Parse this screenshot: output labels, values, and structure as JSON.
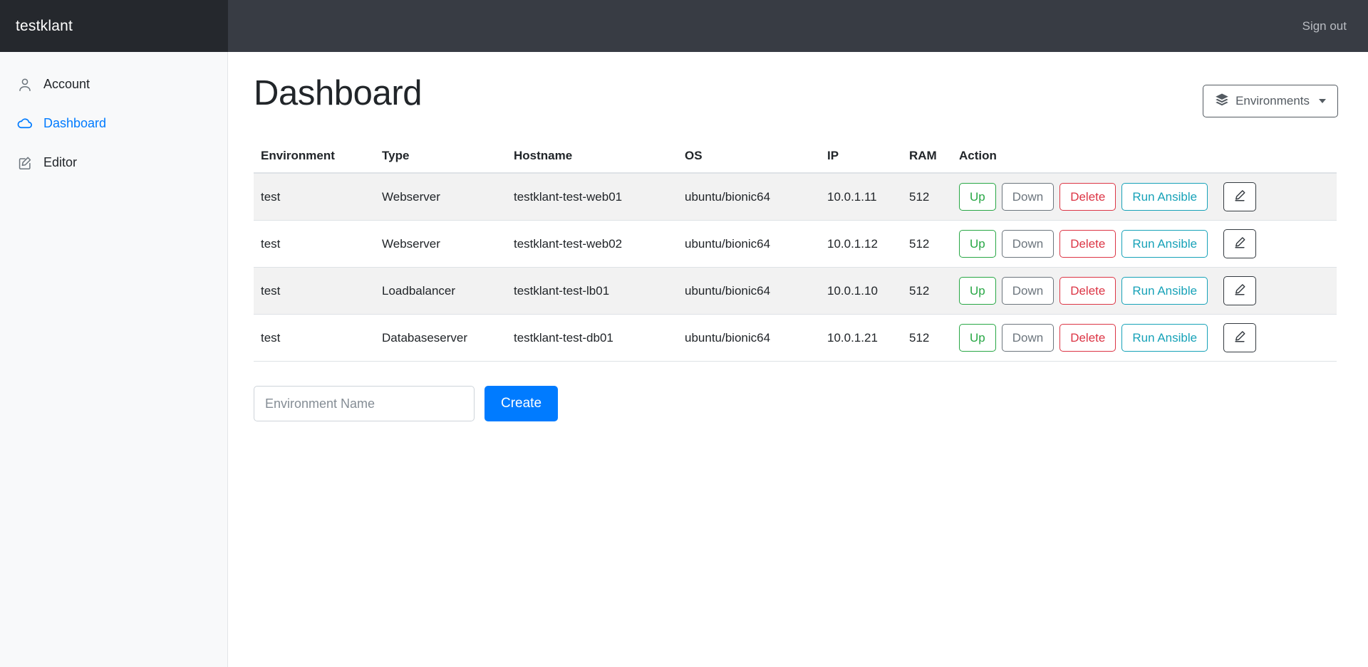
{
  "navbar": {
    "brand": "testklant",
    "signout_label": "Sign out"
  },
  "sidebar": {
    "items": [
      {
        "label": "Account",
        "icon": "person-icon",
        "active": false
      },
      {
        "label": "Dashboard",
        "icon": "cloud-icon",
        "active": true
      },
      {
        "label": "Editor",
        "icon": "pencil-square-icon",
        "active": false
      }
    ]
  },
  "main": {
    "title": "Dashboard",
    "environments_button": {
      "label": "Environments",
      "icon": "layers-icon",
      "caret": "chevron-down-icon"
    },
    "table": {
      "columns": [
        "Environment",
        "Type",
        "Hostname",
        "OS",
        "IP",
        "RAM",
        "Action"
      ],
      "rows": [
        {
          "environment": "test",
          "type": "Webserver",
          "hostname": "testklant-test-web01",
          "os": "ubuntu/bionic64",
          "ip": "10.0.1.11",
          "ram": "512"
        },
        {
          "environment": "test",
          "type": "Webserver",
          "hostname": "testklant-test-web02",
          "os": "ubuntu/bionic64",
          "ip": "10.0.1.12",
          "ram": "512"
        },
        {
          "environment": "test",
          "type": "Loadbalancer",
          "hostname": "testklant-test-lb01",
          "os": "ubuntu/bionic64",
          "ip": "10.0.1.10",
          "ram": "512"
        },
        {
          "environment": "test",
          "type": "Databaseserver",
          "hostname": "testklant-test-db01",
          "os": "ubuntu/bionic64",
          "ip": "10.0.1.21",
          "ram": "512"
        }
      ],
      "action_labels": {
        "up": "Up",
        "down": "Down",
        "delete": "Delete",
        "ansible": "Run Ansible",
        "edit_icon": "pencil-icon"
      }
    },
    "create_form": {
      "input_value": "",
      "input_placeholder": "Environment Name",
      "button_label": "Create"
    }
  },
  "colors": {
    "navbar_bg": "#383c44",
    "brand_bg": "#25282d",
    "sidebar_bg": "#f8f9fa",
    "accent_blue": "#007bff",
    "success_green": "#28a745",
    "secondary_gray": "#6c757d",
    "danger_red": "#dc3545",
    "info_cyan": "#17a2b8",
    "dark": "#343a40",
    "stripe_bg": "#f2f2f2"
  }
}
